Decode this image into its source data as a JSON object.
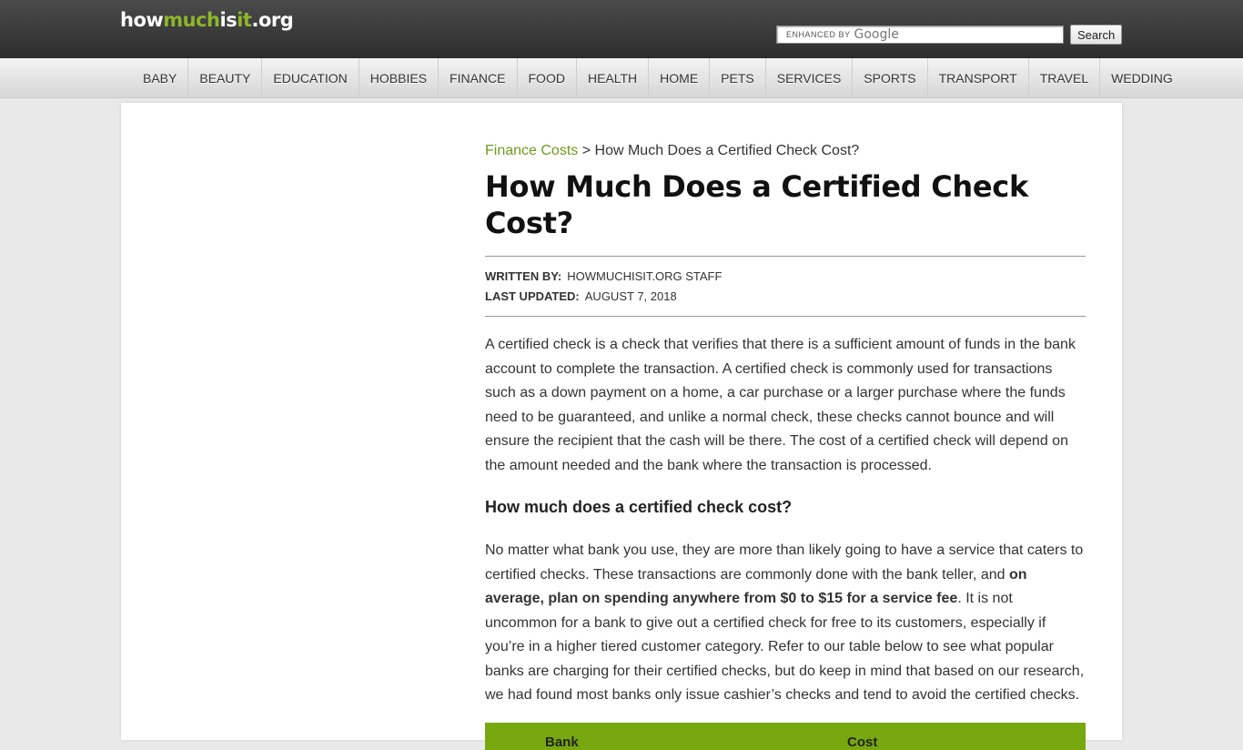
{
  "site": {
    "logo_how": "how",
    "logo_much": "much",
    "logo_is": "is",
    "logo_it": "it",
    "logo_org": ".org"
  },
  "search": {
    "enhanced_label": "ENHANCED BY",
    "google_label": "Google",
    "value": "",
    "button_label": "Search"
  },
  "nav": {
    "items": [
      "BABY",
      "BEAUTY",
      "EDUCATION",
      "HOBBIES",
      "FINANCE",
      "FOOD",
      "HEALTH",
      "HOME",
      "PETS",
      "SERVICES",
      "SPORTS",
      "TRANSPORT",
      "TRAVEL",
      "WEDDING"
    ]
  },
  "breadcrumb": {
    "parent": "Finance Costs",
    "separator": ">",
    "current": "How Much Does a Certified Check Cost?"
  },
  "article": {
    "title": "How Much Does a Certified Check Cost?",
    "written_by_label": "WRITTEN BY:",
    "written_by_value": "HOWMUCHISIT.ORG STAFF",
    "updated_label": "LAST UPDATED:",
    "updated_value": "AUGUST 7, 2018",
    "intro": "A certified check is a check that verifies that there is a sufficient amount of funds in the bank account to complete the transaction.  A certified check is commonly used for transactions such as a down payment on a home, a car purchase or a larger purchase where the funds need to be guaranteed, and unlike a normal check, these checks cannot bounce and will ensure the recipient that the cash will be there.  The cost of a certified check will depend on the amount needed and the bank where the transaction is processed.",
    "subheading": "How much does a certified check cost?",
    "p2_start": "No matter what bank you use, they are more than likely going to have a service that caters to certified checks.  These transactions are commonly done with the bank teller, and ",
    "p2_bold": "on average, plan on spending anywhere from $0 to $15 for a service fee",
    "p2_end": ".  It is not uncommon for a bank to give out a certified check for free to its customers, especially if you’re in a higher tiered customer category.  Refer to our table below to see what popular banks are charging for their certified checks, but do keep in mind that based on our research, we had found most banks only issue cashier’s checks and tend to avoid the certified checks."
  },
  "table": {
    "headers": [
      "Bank",
      "Cost"
    ],
    "header_bg": "#77a80f"
  },
  "colors": {
    "accent": "#8db72a",
    "link": "#6f9a1b"
  }
}
